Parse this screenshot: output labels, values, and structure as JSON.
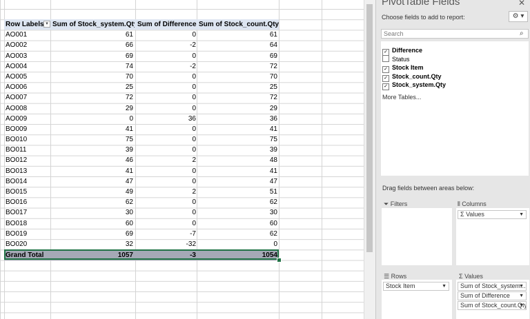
{
  "pivot": {
    "headers": [
      "Row Labels",
      "Sum of Stock_system.Qty",
      "Sum of Difference",
      "Sum of Stock_count.Qty"
    ],
    "rows": [
      [
        "AO001",
        "61",
        "0",
        "61"
      ],
      [
        "AO002",
        "66",
        "-2",
        "64"
      ],
      [
        "AO003",
        "69",
        "0",
        "69"
      ],
      [
        "AO004",
        "74",
        "-2",
        "72"
      ],
      [
        "AO005",
        "70",
        "0",
        "70"
      ],
      [
        "AO006",
        "25",
        "0",
        "25"
      ],
      [
        "AO007",
        "72",
        "0",
        "72"
      ],
      [
        "AO008",
        "29",
        "0",
        "29"
      ],
      [
        "AO009",
        "0",
        "36",
        "36"
      ],
      [
        "BO009",
        "41",
        "0",
        "41"
      ],
      [
        "BO010",
        "75",
        "0",
        "75"
      ],
      [
        "BO011",
        "39",
        "0",
        "39"
      ],
      [
        "BO012",
        "46",
        "2",
        "48"
      ],
      [
        "BO013",
        "41",
        "0",
        "41"
      ],
      [
        "BO014",
        "47",
        "0",
        "47"
      ],
      [
        "BO015",
        "49",
        "2",
        "51"
      ],
      [
        "BO016",
        "62",
        "0",
        "62"
      ],
      [
        "BO017",
        "30",
        "0",
        "30"
      ],
      [
        "BO018",
        "60",
        "0",
        "60"
      ],
      [
        "BO019",
        "69",
        "-7",
        "62"
      ],
      [
        "BO020",
        "32",
        "-32",
        "0"
      ]
    ],
    "grand_total": [
      "Grand Total",
      "1057",
      "-3",
      "1054"
    ]
  },
  "pane": {
    "title": "PivotTable Fields",
    "subtitle": "Choose fields to add to report:",
    "search_placeholder": "Search",
    "fields": [
      {
        "label": "Difference",
        "checked": true
      },
      {
        "label": "Status",
        "checked": false
      },
      {
        "label": "Stock Item",
        "checked": true
      },
      {
        "label": "Stock_count.Qty",
        "checked": true
      },
      {
        "label": "Stock_system.Qty",
        "checked": true
      }
    ],
    "more_tables": "More Tables...",
    "drag_label": "Drag fields between areas below:",
    "areas": {
      "filters": {
        "label": "Filters",
        "items": []
      },
      "columns": {
        "label": "Columns",
        "items": [
          "Σ Values"
        ]
      },
      "rows": {
        "label": "Rows",
        "items": [
          "Stock Item"
        ]
      },
      "values": {
        "label": "Σ Values",
        "items": [
          "Sum of Stock_system....",
          "Sum of Difference",
          "Sum of Stock_count.Qty"
        ]
      }
    }
  },
  "colors": {
    "header_fill": "#dde5f1",
    "grand_total_fill": "#a5a9b6",
    "selection": "#217346"
  }
}
